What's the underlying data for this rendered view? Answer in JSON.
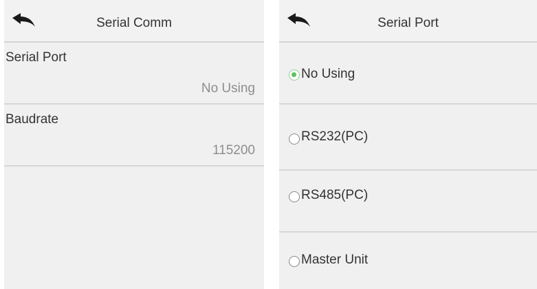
{
  "serial_comm": {
    "title": "Serial Comm",
    "back_icon": "back-arrow-icon",
    "items": [
      {
        "label": "Serial Port",
        "value": "No Using"
      },
      {
        "label": "Baudrate",
        "value": "115200"
      }
    ]
  },
  "serial_port": {
    "title": "Serial Port",
    "back_icon": "back-arrow-icon",
    "selected_color": "#5cc25c",
    "options": [
      {
        "label": "No Using",
        "selected": true
      },
      {
        "label": "RS232(PC)",
        "selected": false
      },
      {
        "label": "RS485(PC)",
        "selected": false
      },
      {
        "label": "Master Unit",
        "selected": false
      }
    ]
  }
}
